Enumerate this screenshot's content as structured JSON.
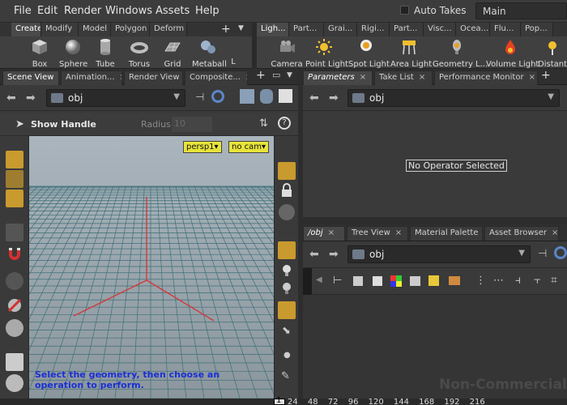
{
  "menu": [
    "File",
    "Edit",
    "Render",
    "Windows",
    "Assets",
    "Help"
  ],
  "auto_takes": "Auto Takes",
  "desktop": "Main",
  "shelf_left": {
    "tabs": [
      "Create",
      "Modify",
      "Model",
      "Polygon",
      "Deform"
    ],
    "tools": [
      "Box",
      "Sphere",
      "Tube",
      "Torus",
      "Grid",
      "Metaball",
      "L"
    ]
  },
  "shelf_right": {
    "tabs": [
      "Ligh...",
      "Part...",
      "Grai...",
      "Rigi...",
      "Part...",
      "Visc...",
      "Ocea...",
      "Flu...",
      "Pop..."
    ],
    "tools": [
      "Camera",
      "Point Light",
      "Spot Light",
      "Area Light",
      "Geometry L...",
      "Volume Light",
      "Distant"
    ]
  },
  "left_pane": {
    "tabs": [
      "Scene View",
      "Animation...",
      "Render View",
      "Composite..."
    ],
    "path": "obj"
  },
  "handle_bar": {
    "title": "Show Handle",
    "radius_label": "Radius",
    "radius_value": "10"
  },
  "viewport": {
    "camera": "persp1▾",
    "cam_select": "no cam▾",
    "hint": "Select the geometry, then choose an operation to perform.",
    "grid_color": "#3d6f77",
    "axis_color": "#d23a3a"
  },
  "param_pane": {
    "tabs": [
      "Parameters",
      "Take List",
      "Performance Monitor"
    ],
    "path": "obj",
    "message": "No Operator Selected"
  },
  "network_pane": {
    "tabs": [
      "/obj",
      "Tree View",
      "Material Palette",
      "Asset Browser"
    ],
    "path": "obj",
    "watermark": "Non-Commercial Ed"
  },
  "timeline": {
    "current_frame": "1",
    "ticks": "24 48 72 96 120 144 168 192 216"
  }
}
